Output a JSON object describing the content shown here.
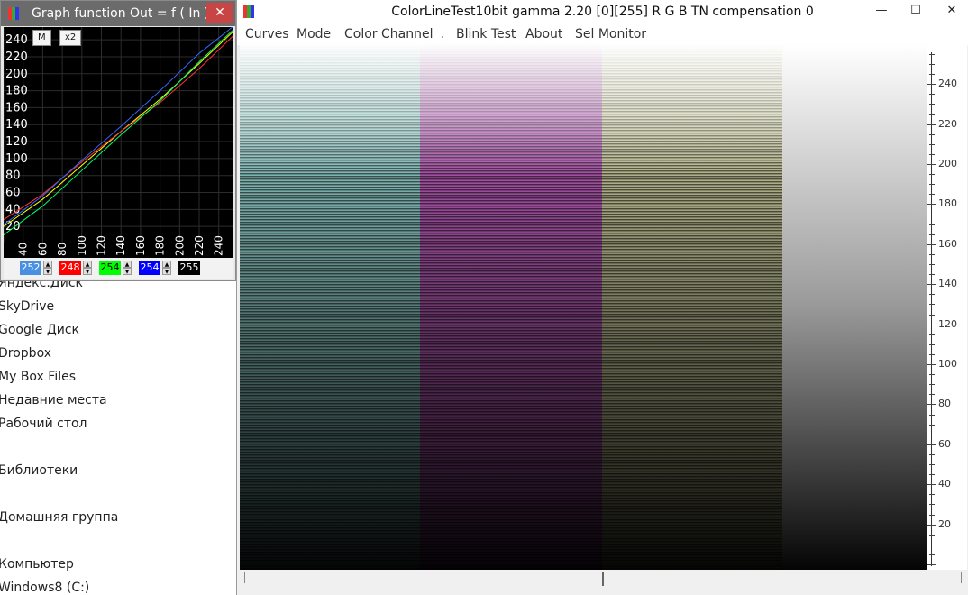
{
  "graph_window": {
    "title": "Graph function Out = f ( In )",
    "close": "✕",
    "button_m": "M",
    "button_x2": "x2",
    "y_ticks": [
      "240",
      "220",
      "200",
      "180",
      "160",
      "140",
      "120",
      "100",
      "80",
      "60",
      "40",
      "20"
    ],
    "x_ticks": [
      "40",
      "60",
      "80",
      "100",
      "120",
      "140",
      "160",
      "180",
      "200",
      "220",
      "240"
    ],
    "spinners": [
      {
        "value": "252",
        "bg": "#4a90e2",
        "fg": "#ffffff"
      },
      {
        "value": "248",
        "bg": "#ff0000",
        "fg": "#ffffff"
      },
      {
        "value": "254",
        "bg": "#00ff00",
        "fg": "#000000"
      },
      {
        "value": "254",
        "bg": "#0000ff",
        "fg": "#ffffff"
      },
      {
        "value": "255",
        "bg": "#000000",
        "fg": "#ffffff"
      }
    ]
  },
  "main_window": {
    "title": "ColorLineTest10bit gamma 2.20 [0][255]   R G B  TN compensation 0",
    "minimize": "—",
    "maximize": "☐",
    "close": "✕",
    "menu": [
      "Curves",
      "Mode",
      "Color Channel",
      ".",
      "Blink Test",
      "About",
      "Sel Monitor"
    ],
    "ruler_labels": [
      "240",
      "220",
      "200",
      "180",
      "160",
      "140",
      "120",
      "100",
      "80",
      "60",
      "40",
      "20"
    ]
  },
  "nav_list": [
    "Яндекс.Диск",
    "SkyDrive",
    "Google Диск",
    "Dropbox",
    "My Box Files",
    "Недавние места",
    "Рабочий стол",
    "Библиотеки",
    "Домашняя группа",
    "Компьютер",
    "Windows8 (C:)"
  ],
  "colors": {
    "cyan_bar": "#8ecac6",
    "magenta_bar": "#b45ab4",
    "yellow_bar": "#c6c69a",
    "gray_bar": "#ffffff"
  },
  "chart_data": {
    "type": "line",
    "xlim": [
      20,
      255
    ],
    "ylim": [
      0,
      255
    ],
    "series": [
      {
        "color": "#ffff00",
        "x": [
          20,
          60,
          100,
          140,
          180,
          220,
          255
        ],
        "y": [
          20,
          52,
          92,
          132,
          170,
          212,
          250
        ]
      },
      {
        "color": "#ff3333",
        "x": [
          20,
          60,
          100,
          140,
          180,
          220,
          255
        ],
        "y": [
          28,
          58,
          96,
          132,
          166,
          206,
          245
        ]
      },
      {
        "color": "#00ff66",
        "x": [
          20,
          60,
          100,
          140,
          180,
          220,
          255
        ],
        "y": [
          10,
          44,
          86,
          128,
          168,
          214,
          252
        ]
      },
      {
        "color": "#3366ff",
        "x": [
          20,
          60,
          100,
          140,
          180,
          220,
          255
        ],
        "y": [
          22,
          56,
          98,
          138,
          180,
          224,
          256
        ]
      }
    ]
  }
}
